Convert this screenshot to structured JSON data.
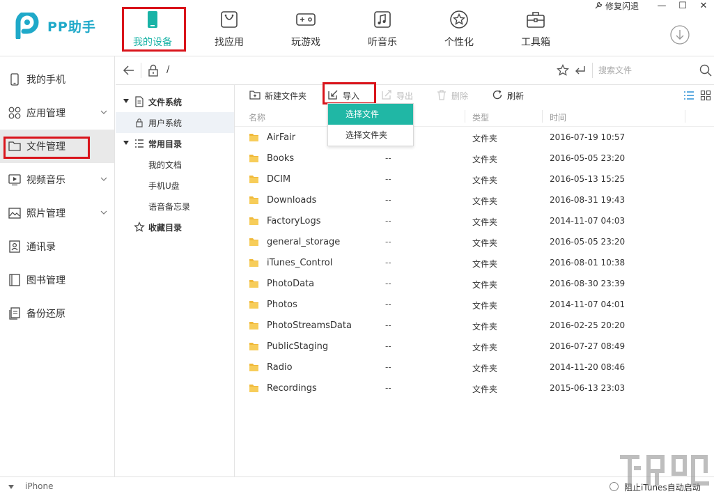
{
  "app": {
    "name": "PP助手",
    "brand_color": "#1fa9c9",
    "accent_color": "#19b3a6",
    "highlight_red": "#d9141b"
  },
  "window": {
    "repair_label": "修复闪退",
    "minimize": "—",
    "maximize": "☐",
    "close": "✕"
  },
  "nav": {
    "tabs": [
      {
        "label": "我的设备",
        "icon": "phone-icon",
        "active": true
      },
      {
        "label": "找应用",
        "icon": "app-bag-icon"
      },
      {
        "label": "玩游戏",
        "icon": "gamepad-icon"
      },
      {
        "label": "听音乐",
        "icon": "music-icon"
      },
      {
        "label": "个性化",
        "icon": "star-circle-icon"
      },
      {
        "label": "工具箱",
        "icon": "toolbox-icon"
      }
    ]
  },
  "sidebar": {
    "items": [
      {
        "label": "我的手机",
        "icon": "phone-icon"
      },
      {
        "label": "应用管理",
        "icon": "apps-grid-icon",
        "expandable": true
      },
      {
        "label": "文件管理",
        "icon": "folder-icon",
        "active": true
      },
      {
        "label": "视频音乐",
        "icon": "video-icon",
        "expandable": true
      },
      {
        "label": "照片管理",
        "icon": "photo-icon",
        "expandable": true
      },
      {
        "label": "通讯录",
        "icon": "contacts-icon"
      },
      {
        "label": "图书管理",
        "icon": "book-icon"
      },
      {
        "label": "备份还原",
        "icon": "backup-icon"
      }
    ]
  },
  "addressbar": {
    "path": "/",
    "search_placeholder": "搜索文件"
  },
  "tree": {
    "file_system": "文件系统",
    "user_system": "用户系统",
    "common_dirs": "常用目录",
    "my_docs": "我的文档",
    "phone_udisk": "手机U盘",
    "voice_memos": "语音备忘录",
    "favorites": "收藏目录"
  },
  "toolbar": {
    "new_folder": "新建文件夹",
    "import": "导入",
    "export": "导出",
    "delete": "删除",
    "refresh": "刷新"
  },
  "import_menu": {
    "select_file": "选择文件",
    "select_folder": "选择文件夹"
  },
  "columns": {
    "name": "名称",
    "type": "类型",
    "time": "时间"
  },
  "files": [
    {
      "name": "AirFair",
      "size": "",
      "type": "文件夹",
      "time": "2016-07-19 10:57"
    },
    {
      "name": "Books",
      "size": "--",
      "type": "文件夹",
      "time": "2016-05-05 23:20"
    },
    {
      "name": "DCIM",
      "size": "--",
      "type": "文件夹",
      "time": "2016-05-13 15:25"
    },
    {
      "name": "Downloads",
      "size": "--",
      "type": "文件夹",
      "time": "2016-08-31 19:43"
    },
    {
      "name": "FactoryLogs",
      "size": "--",
      "type": "文件夹",
      "time": "2014-11-07 04:03"
    },
    {
      "name": "general_storage",
      "size": "--",
      "type": "文件夹",
      "time": "2016-05-05 23:20"
    },
    {
      "name": "iTunes_Control",
      "size": "--",
      "type": "文件夹",
      "time": "2016-08-01 10:38"
    },
    {
      "name": "PhotoData",
      "size": "--",
      "type": "文件夹",
      "time": "2016-08-30 23:39"
    },
    {
      "name": "Photos",
      "size": "--",
      "type": "文件夹",
      "time": "2014-11-07 04:01"
    },
    {
      "name": "PhotoStreamsData",
      "size": "--",
      "type": "文件夹",
      "time": "2016-02-25 20:20"
    },
    {
      "name": "PublicStaging",
      "size": "--",
      "type": "文件夹",
      "time": "2016-07-27 08:49"
    },
    {
      "name": "Radio",
      "size": "--",
      "type": "文件夹",
      "time": "2014-11-20 08:46"
    },
    {
      "name": "Recordings",
      "size": "--",
      "type": "文件夹",
      "time": "2015-06-13 23:03"
    }
  ],
  "statusbar": {
    "device": "iPhone",
    "itunes_block": "阻止iTunes自动启动"
  }
}
